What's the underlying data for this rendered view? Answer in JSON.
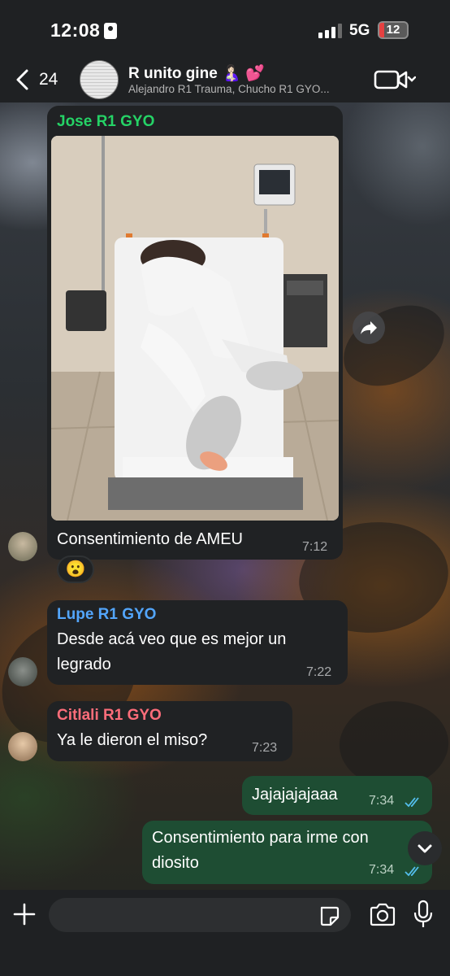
{
  "status_bar": {
    "time": "12:08",
    "network": "5G",
    "battery": "12"
  },
  "header": {
    "back_count": "24",
    "group_name": "R unito gine 🤱🏻 💕",
    "members": "Alejandro R1 Trauma, Chucho R1 GYO..."
  },
  "messages": [
    {
      "sender": "Jose R1 GYO",
      "sender_color": "#25d366",
      "caption": "Consentimiento de AMEU",
      "time": "7:12",
      "reaction": "😮",
      "has_photo": true
    },
    {
      "sender": "Lupe R1 GYO",
      "sender_color": "#53a6fd",
      "lines": [
        "Desde acá veo que es mejor un",
        "legrado"
      ],
      "time": "7:22"
    },
    {
      "sender": "Citlali R1 GYO",
      "sender_color": "#fd6d7a",
      "text": "Ya le dieron el miso?",
      "time": "7:23"
    },
    {
      "outgoing": true,
      "text": "Jajajajajaaa",
      "time": "7:34",
      "status": "read"
    },
    {
      "outgoing": true,
      "lines": [
        "Consentimiento para irme con",
        "diosito"
      ],
      "time": "7:34",
      "status": "read"
    }
  ],
  "composer": {
    "placeholder": ""
  },
  "icons": [
    "back-chevron-icon",
    "video-call-icon",
    "forward-icon",
    "scroll-down-icon",
    "plus-icon",
    "sticker-icon",
    "camera-icon",
    "microphone-icon"
  ]
}
